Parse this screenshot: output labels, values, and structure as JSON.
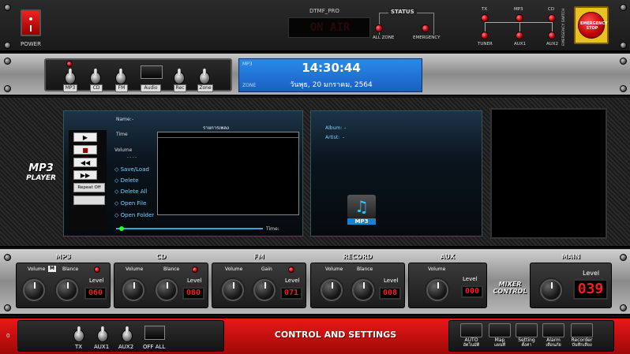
{
  "top": {
    "power_label": "POWER",
    "device_name": "DTMF_PRO",
    "status_title": "STATUS",
    "status_all_zone": "ALL ZONE",
    "status_emergency": "EMERGENCY",
    "dtmf_display": "ON AIR",
    "routes": {
      "tx": "TX",
      "mp3": "MP3",
      "cd": "CD",
      "tuner": "TUNER",
      "aux1": "AUX1",
      "aux2": "AUX2"
    },
    "emergency_stop": "EMERGENCY STOP",
    "emergency_switch": "EMERGENCY SWITCH"
  },
  "source_bar": {
    "sources": [
      "MP3",
      "CD",
      "FM",
      "Audio",
      "Rec",
      "Zone"
    ]
  },
  "clock": {
    "mp3_tag": "MP3",
    "zone_tag": "ZONE",
    "time": "14:30:44",
    "date": "วันพุธ, 20 มกราคม, 2564"
  },
  "player": {
    "logo_line1": "MP3",
    "logo_line2": "PLAYER",
    "name_label": "Name:",
    "name_value": "-",
    "playlist_title": "รายการเพลง",
    "time_label": "Time",
    "volume_label": "Volume",
    "volume_value": "- - - -",
    "repeat_label": "Repeat Off",
    "menu": [
      "Save/Load",
      "Delete",
      "Delete All",
      "Open File",
      "Open Folder"
    ],
    "progress_label": "Time:",
    "progress_fraction": 0.02,
    "album_label": "Album:",
    "album_value": "-",
    "artist_label": "Artist:",
    "artist_value": "-",
    "cover_label": "MP3"
  },
  "mixer": {
    "channels": [
      {
        "title": "MP3",
        "k1": "Volume",
        "k2": "Blance",
        "badge": "M",
        "level_label": "Level",
        "level": "060"
      },
      {
        "title": "CD",
        "k1": "Volume",
        "k2": "Blance",
        "level_label": "Level",
        "level": "080"
      },
      {
        "title": "FM",
        "k1": "Volume",
        "k2": "Gain",
        "level_label": "Level",
        "level": "071"
      },
      {
        "title": "RECORD",
        "k1": "Volume",
        "k2": "Blance",
        "level_label": "Level",
        "level": "008"
      },
      {
        "title": "AUX",
        "k1": "Volume",
        "level_label": "Level",
        "level": "000"
      }
    ],
    "mixer_control_line1": "MIXER",
    "mixer_control_line2": "CONTROL",
    "main_title": "MAIN",
    "main_level_label": "Level",
    "main_level": "039"
  },
  "control": {
    "zero": "0",
    "toggles": [
      "TX",
      "AUX1",
      "AUX2"
    ],
    "off_all": "OFF ALL",
    "banner": "CONTROL AND SETTINGS",
    "buttons": [
      {
        "en": "AUTO",
        "th": "อัตโนมัติ"
      },
      {
        "en": "Map",
        "th": "แผนที่"
      },
      {
        "en": "Setting",
        "th": "ตั้งค่า"
      },
      {
        "en": "Alarm",
        "th": "เตือนภัย"
      },
      {
        "en": "Recorder",
        "th": "บันทึกเสียง"
      }
    ]
  },
  "colors": {
    "accent_red": "#e01010",
    "clock_blue": "#1a6fd0",
    "led_red": "#d00010"
  }
}
